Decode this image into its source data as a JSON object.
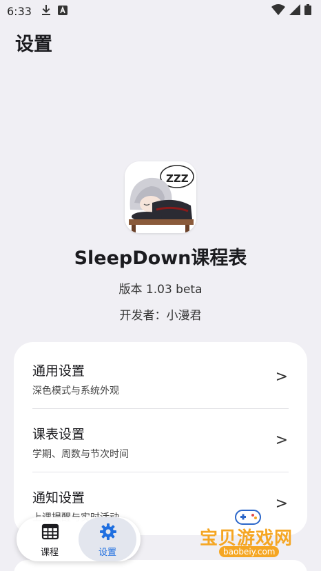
{
  "status_bar": {
    "time": "6:33"
  },
  "page": {
    "title": "设置"
  },
  "app_info": {
    "name": "SleepDown课程表",
    "version": "版本 1.03 beta",
    "developer": "开发者：小漫君",
    "logo_text": "ZZZ"
  },
  "settings": [
    {
      "title": "通用设置",
      "subtitle": "深色模式与系统外观",
      "arrow": ">"
    },
    {
      "title": "课表设置",
      "subtitle": "学期、周数与节次时间",
      "arrow": ">"
    },
    {
      "title": "通知设置",
      "subtitle": "上课提醒与实时活动",
      "arrow": ">"
    }
  ],
  "bottom_nav": [
    {
      "label": "课程",
      "icon": "calendar-grid-icon",
      "active": false
    },
    {
      "label": "设置",
      "icon": "gear-icon",
      "active": true
    }
  ],
  "watermark": {
    "text": "宝贝游戏网",
    "subtext": "baobeiy.com"
  },
  "colors": {
    "background": "#f0eff4",
    "card": "#ffffff",
    "accent": "#1f6fe0",
    "watermark": "#f5a623"
  }
}
